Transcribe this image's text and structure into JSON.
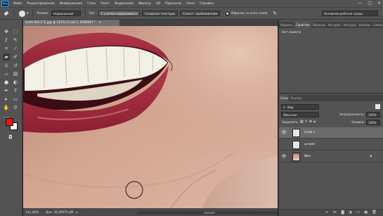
{
  "app": {
    "logo": "Ps"
  },
  "menu": [
    "Файл",
    "Редактирование",
    "Изображение",
    "Слои",
    "Текст",
    "Выделение",
    "Фильтр",
    "3D",
    "Просмотр",
    "Окно",
    "Справка"
  ],
  "window_controls": [
    "—",
    "□",
    "✕"
  ],
  "options": {
    "mode_label": "Режим:",
    "mode_value": "Нормальный",
    "type_label": "Тип:",
    "type_opt1": "С учетом содержимого",
    "type_opt2": "Создание текстуры",
    "type_opt3": "Сопост. приближения",
    "sample_all_label": "Образец со всех слоев",
    "workspace": "Основная рабочая среда"
  },
  "document": {
    "tab_title": "teeth-841172.jpg @ 141% (Слой 1, RGB/8#) *",
    "tab_close": "×",
    "zoom": "141,48%",
    "doc_info": "Док: 39,4M/75,4M",
    "status_arrow": "▸"
  },
  "properties_panel": {
    "tabs": [
      "Коррекц",
      "Свойства",
      "Образцы",
      "История",
      "Контуры",
      "Каналы",
      "Символ"
    ],
    "active_tab": "Свойства",
    "content": "Нет свойств"
  },
  "layers_panel": {
    "tabs": [
      "Слои",
      "Каналы"
    ],
    "active_tab": "Слои",
    "kind_label": "Вид",
    "blend_mode": "Обычные",
    "opacity_label": "Непрозрачность:",
    "opacity_value": "100%",
    "lock_label": "Закрепить:",
    "fill_label": "Заливка:",
    "fill_value": "100%",
    "layers": [
      {
        "name": "Слой 1",
        "visible": true,
        "selected": true,
        "thumb": "transparent"
      },
      {
        "name": "штамп",
        "visible": false,
        "selected": false,
        "thumb": "transparent"
      },
      {
        "name": "Фон",
        "visible": true,
        "selected": false,
        "thumb": "photo",
        "locked": true
      }
    ]
  },
  "colors": {
    "foreground": "#e11a1a",
    "background": "#ffffff",
    "accent": "#2ea3ff"
  }
}
